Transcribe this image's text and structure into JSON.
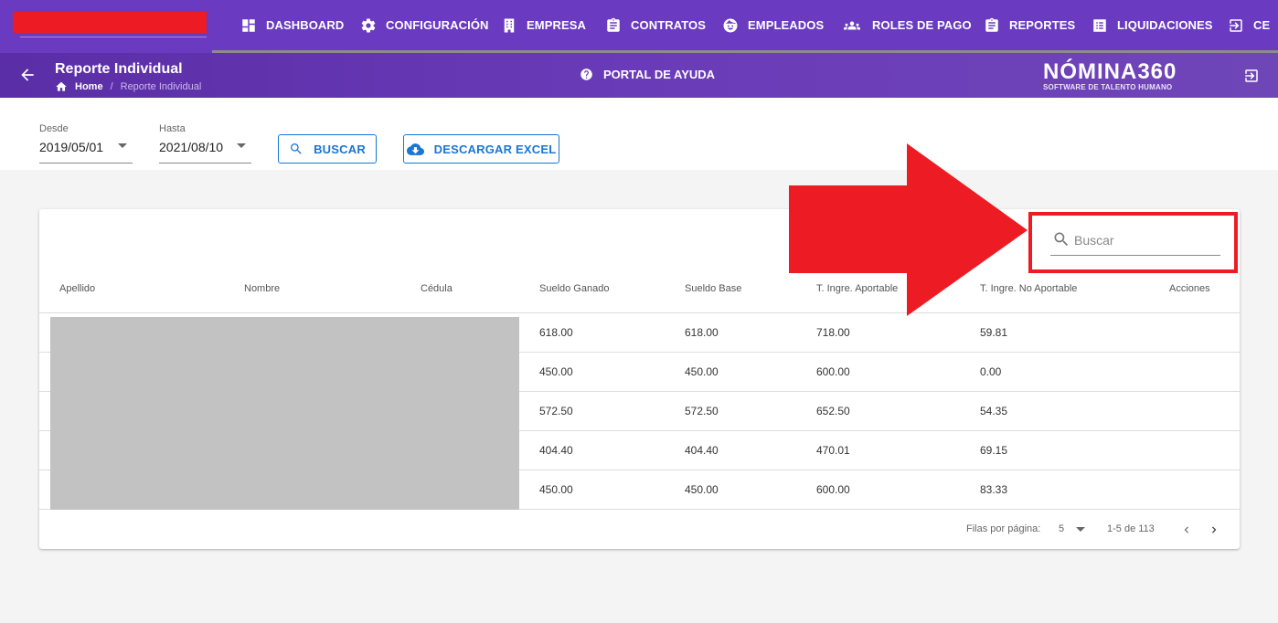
{
  "topnav": {
    "items": [
      {
        "label": "DASHBOARD",
        "icon": "dashboard-icon"
      },
      {
        "label": "CONFIGURACIÓN",
        "icon": "gear-icon"
      },
      {
        "label": "EMPRESA",
        "icon": "building-icon"
      },
      {
        "label": "CONTRATOS",
        "icon": "clipboard-icon"
      },
      {
        "label": "EMPLEADOS",
        "icon": "face-icon"
      },
      {
        "label": "ROLES DE PAGO",
        "icon": "people-icon"
      },
      {
        "label": "REPORTES",
        "icon": "report-icon"
      },
      {
        "label": "LIQUIDACIONES",
        "icon": "list-icon"
      },
      {
        "label": "CE",
        "icon": "logout-icon"
      }
    ]
  },
  "subheader": {
    "title": "Reporte Individual",
    "breadcrumb_home": "Home",
    "breadcrumb_sep": "/",
    "breadcrumb_current": "Reporte Individual",
    "help_label": "PORTAL DE AYUDA",
    "logo_text": "NÓMINA360",
    "logo_tagline": "SOFTWARE DE TALENTO HUMANO"
  },
  "filters": {
    "desde_label": "Desde",
    "desde_value": "2019/05/01",
    "hasta_label": "Hasta",
    "hasta_value": "2021/08/10",
    "buscar_label": "BUSCAR",
    "excel_label": "DESCARGAR EXCEL"
  },
  "search": {
    "placeholder": "Buscar"
  },
  "table": {
    "columns": [
      "Apellido",
      "Nombre",
      "Cédula",
      "Sueldo Ganado",
      "Sueldo Base",
      "T. Ingre. Aportable",
      "T. Ingre. No Aportable",
      "Acciones"
    ],
    "rows": [
      {
        "sueldo_ganado": "618.00",
        "sueldo_base": "618.00",
        "aportable": "718.00",
        "no_aportable": "59.81"
      },
      {
        "sueldo_ganado": "450.00",
        "sueldo_base": "450.00",
        "aportable": "600.00",
        "no_aportable": "0.00"
      },
      {
        "sueldo_ganado": "572.50",
        "sueldo_base": "572.50",
        "aportable": "652.50",
        "no_aportable": "54.35"
      },
      {
        "sueldo_ganado": "404.40",
        "sueldo_base": "404.40",
        "aportable": "470.01",
        "no_aportable": "69.15"
      },
      {
        "sueldo_ganado": "450.00",
        "sueldo_base": "450.00",
        "aportable": "600.00",
        "no_aportable": "83.33"
      }
    ]
  },
  "pagination": {
    "rows_per_page_label": "Filas por página:",
    "rows_per_page": "5",
    "range": "1-5 de 113"
  },
  "colors": {
    "nav_purple": "#6a3bc0",
    "accent_blue": "#1976d2",
    "highlight_red": "#ed1c24"
  }
}
